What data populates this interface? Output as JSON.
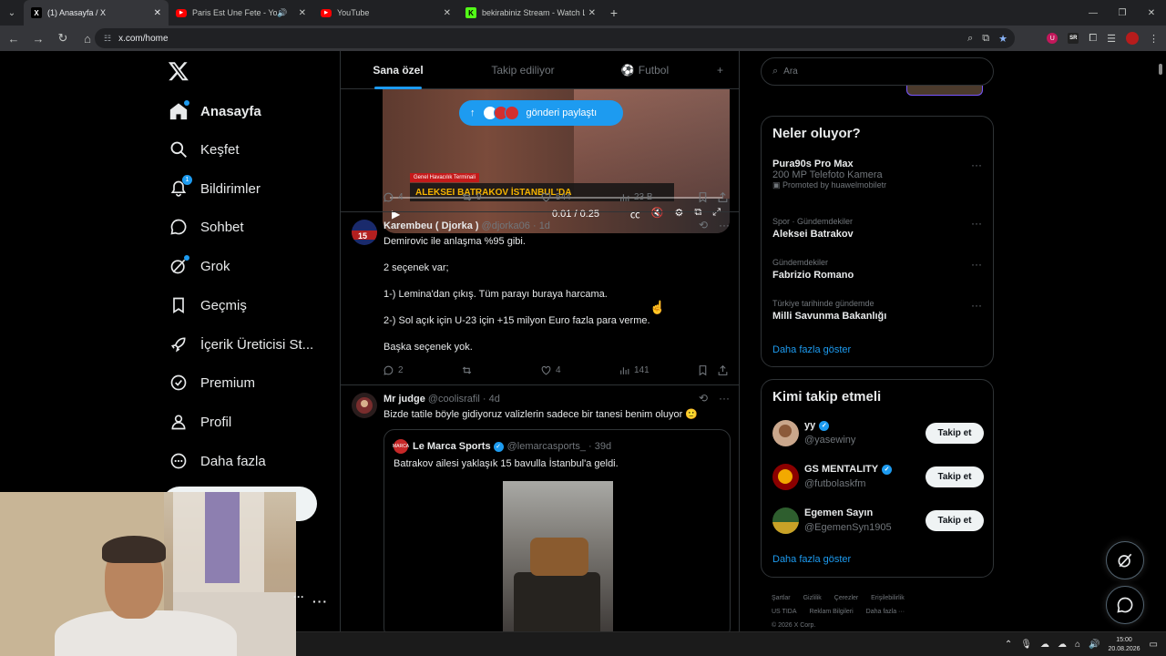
{
  "browser": {
    "tabs": [
      {
        "title": "(1) Anasayfa / X",
        "favicon": "x-favicon",
        "active": true
      },
      {
        "title": "Paris Est Une Fete - YouTube",
        "favicon": "youtube-favicon",
        "active": false
      },
      {
        "title": "YouTube",
        "favicon": "youtube-favicon",
        "active": false
      },
      {
        "title": "bekirabiniz Stream - Watch Live",
        "favicon": "kick-favicon",
        "active": false
      }
    ],
    "url": "x.com/home"
  },
  "sidebar": {
    "items": [
      {
        "label": "Anasayfa",
        "icon": "home-icon"
      },
      {
        "label": "Keşfet",
        "icon": "search-icon"
      },
      {
        "label": "Bildirimler",
        "icon": "bell-icon",
        "badge": "1"
      },
      {
        "label": "Sohbet",
        "icon": "chat-icon"
      },
      {
        "label": "Grok",
        "icon": "grok-icon"
      },
      {
        "label": "Geçmiş",
        "icon": "bookmark-icon"
      },
      {
        "label": "İçerik Üreticisi St...",
        "icon": "rocket-icon"
      },
      {
        "label": "Premium",
        "icon": "verified-badge-icon"
      },
      {
        "label": "Profil",
        "icon": "person-icon"
      },
      {
        "label": "Daha fazla",
        "icon": "more-circle-icon"
      }
    ]
  },
  "feed_tabs": [
    {
      "label": "Sana özel",
      "active": true
    },
    {
      "label": "Takip ediliyor",
      "active": false
    },
    {
      "label": "Futbol",
      "active": false,
      "icon": "soccer-ball-icon"
    }
  ],
  "video": {
    "share_label": "gönderi paylaştı",
    "lower_third_tag": "Genel Havacılık Terminali",
    "lower_third_headline": "ALEKSEI BATRAKOV İSTANBUL'DA",
    "time": "0:01 / 0:25"
  },
  "post1_actions": {
    "replies": "4",
    "reposts": "9",
    "likes": "544",
    "views": "23 B"
  },
  "post2": {
    "name": "Karembeu ( Djorka )",
    "handle": "@djorka06",
    "time": "1d",
    "lines": [
      "Demirovic ile anlaşma %95 gibi.",
      "",
      "2 seçenek var;",
      "",
      "1-) Lemina'dan çıkış. Tüm parayı buraya harcama.",
      "",
      "2-) Sol açık için U-23 için +15 milyon Euro fazla para verme.",
      "",
      "Başka seçenek yok."
    ],
    "actions": {
      "replies": "2",
      "reposts": "",
      "likes": "4",
      "views": "141"
    }
  },
  "post3": {
    "name": "Mr judge",
    "handle": "@coolisrafil",
    "time": "4d",
    "text": "Bizde tatile böyle gidiyoruz valizlerin sadece bir tanesi benim oluyor 🙂",
    "quote": {
      "name": "Le Marca Sports",
      "handle": "@lemarcasports_",
      "time": "39d",
      "text": "Batrakov ailesi yaklaşık 15 bavulla İstanbul'a geldi."
    }
  },
  "right": {
    "search_placeholder": "Ara",
    "trends_title": "Neler oluyor?",
    "trends": [
      {
        "context": "",
        "title": "Pura90s Pro Max",
        "subtitle": "200 MP Telefoto Kamera",
        "promo": "Promoted by huawelmobiletr"
      },
      {
        "context": "Spor · Gündemdekiler",
        "title": "Aleksei Batrakov",
        "subtitle": "",
        "promo": ""
      },
      {
        "context": "Gündemdekiler",
        "title": "Fabrizio Romano",
        "subtitle": "",
        "promo": ""
      },
      {
        "context": "Türkiye tarihinde gündemde",
        "title": "Milli Savunma Bakanlığı",
        "subtitle": "",
        "promo": ""
      }
    ],
    "trends_more": "Daha fazla göster",
    "follow_title": "Kimi takip etmeli",
    "follow": [
      {
        "name": "yy",
        "handle": "@yasewiny",
        "verified": true,
        "button": "Takip et"
      },
      {
        "name": "GS MENTALITY",
        "handle": "@futbolaskfm",
        "verified": true,
        "button": "Takip et"
      },
      {
        "name": "Egemen Sayın",
        "handle": "@EgemenSyn1905",
        "verified": false,
        "button": "Takip et"
      }
    ],
    "follow_more": "Daha fazla göster",
    "footer": [
      "Şartlar",
      "Gizlilik",
      "Çerezler",
      "Erişilebilirlik",
      "US TIDA",
      "Reklam Bilgileri",
      "Daha fazla ···",
      "© 2026 X Corp."
    ]
  },
  "taskbar": {
    "time": "15:00",
    "date": "20.08.2026"
  },
  "colors": {
    "accent": "#1d9bf0",
    "bg": "#000000",
    "border": "#2f3336",
    "muted": "#71767b",
    "text": "#e7e9ea"
  }
}
